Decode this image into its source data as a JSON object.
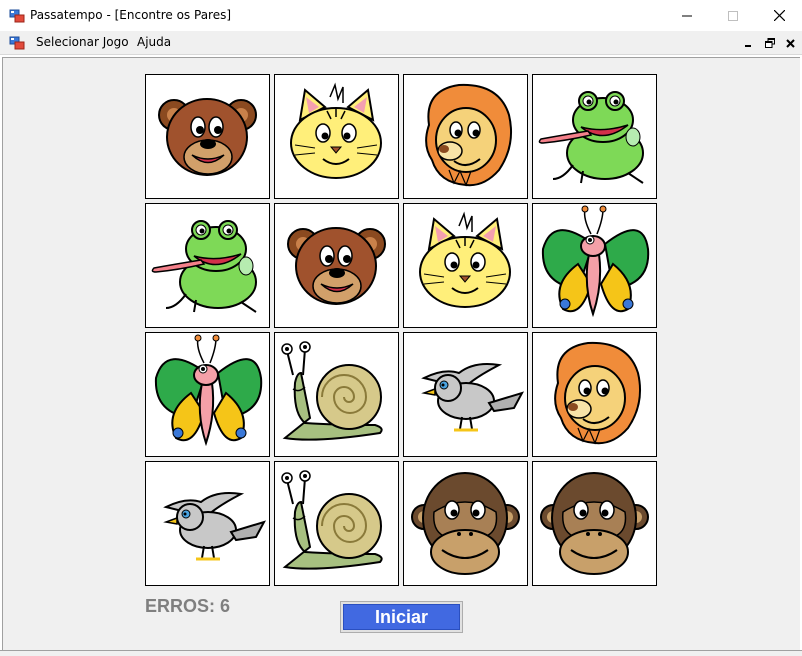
{
  "window": {
    "title": "Passatempo - [Encontre os Pares]",
    "icon": "app-window-icon"
  },
  "menu": {
    "items": [
      {
        "label": "Selecionar Jogo"
      },
      {
        "label": "Ajuda"
      }
    ]
  },
  "board": {
    "rows": 4,
    "cols": 4,
    "cards": [
      [
        "bear",
        "cat",
        "lion",
        "frog"
      ],
      [
        "frog",
        "bear",
        "cat",
        "butterfly"
      ],
      [
        "butterfly",
        "snail",
        "bird",
        "lion"
      ],
      [
        "bird",
        "snail",
        "monkey",
        "monkey"
      ]
    ]
  },
  "status": {
    "errors_label": "ERROS:",
    "errors_value": "6"
  },
  "actions": {
    "start_label": "Iniciar"
  },
  "colors": {
    "start_button": "#4169e1",
    "errors_text": "#7f7f7f",
    "client_bg": "#f0f0f0"
  }
}
